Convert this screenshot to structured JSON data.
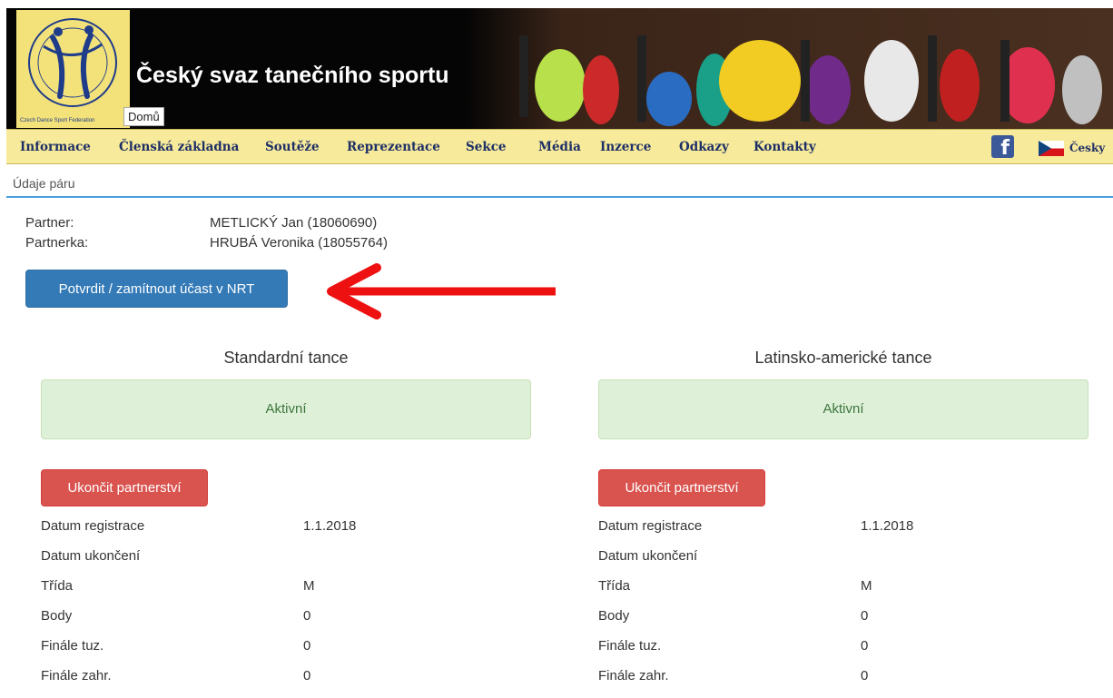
{
  "header": {
    "site_title": "Český svaz tanečního sportu",
    "logo_caption": "Czech Dance Sport Federation",
    "home_link": "Domů"
  },
  "nav": {
    "items": [
      "Informace",
      "Členská základna",
      "Soutěže",
      "Reprezentace",
      "Sekce",
      "Média",
      "Inzerce",
      "Odkazy",
      "Kontakty"
    ],
    "language": "Česky",
    "facebook_icon": "facebook-icon",
    "flag_icon": "czech-flag-icon"
  },
  "breadcrumb": "Údaje páru",
  "couple": {
    "partner_label": "Partner:",
    "partner_value": "METLICKÝ Jan (18060690)",
    "partnerka_label": "Partnerka:",
    "partnerka_value": "HRUBÁ Veronika (18055764)"
  },
  "nrt_button": "Potvrdit / zamítnout účast v NRT",
  "columns": [
    {
      "title": "Standardní tance",
      "status": "Aktivní",
      "end_button": "Ukončit partnerství",
      "rows": [
        {
          "label": "Datum registrace",
          "value": "1.1.2018"
        },
        {
          "label": "Datum ukončení",
          "value": ""
        },
        {
          "label": "Třída",
          "value": "M"
        },
        {
          "label": "Body",
          "value": "0"
        },
        {
          "label": "Finále tuz.",
          "value": "0"
        },
        {
          "label": "Finále zahr.",
          "value": "0"
        }
      ]
    },
    {
      "title": "Latinsko-americké tance",
      "status": "Aktivní",
      "end_button": "Ukončit partnerství",
      "rows": [
        {
          "label": "Datum registrace",
          "value": "1.1.2018"
        },
        {
          "label": "Datum ukončení",
          "value": ""
        },
        {
          "label": "Třída",
          "value": "M"
        },
        {
          "label": "Body",
          "value": "0"
        },
        {
          "label": "Finále tuz.",
          "value": "0"
        },
        {
          "label": "Finále zahr.",
          "value": "0"
        }
      ]
    }
  ],
  "colors": {
    "nav_bg": "#f7ea9a",
    "primary": "#337ab7",
    "danger": "#d9534f",
    "success_bg": "#dff0d8",
    "success_text": "#3c763d",
    "arrow": "#ee1111"
  }
}
